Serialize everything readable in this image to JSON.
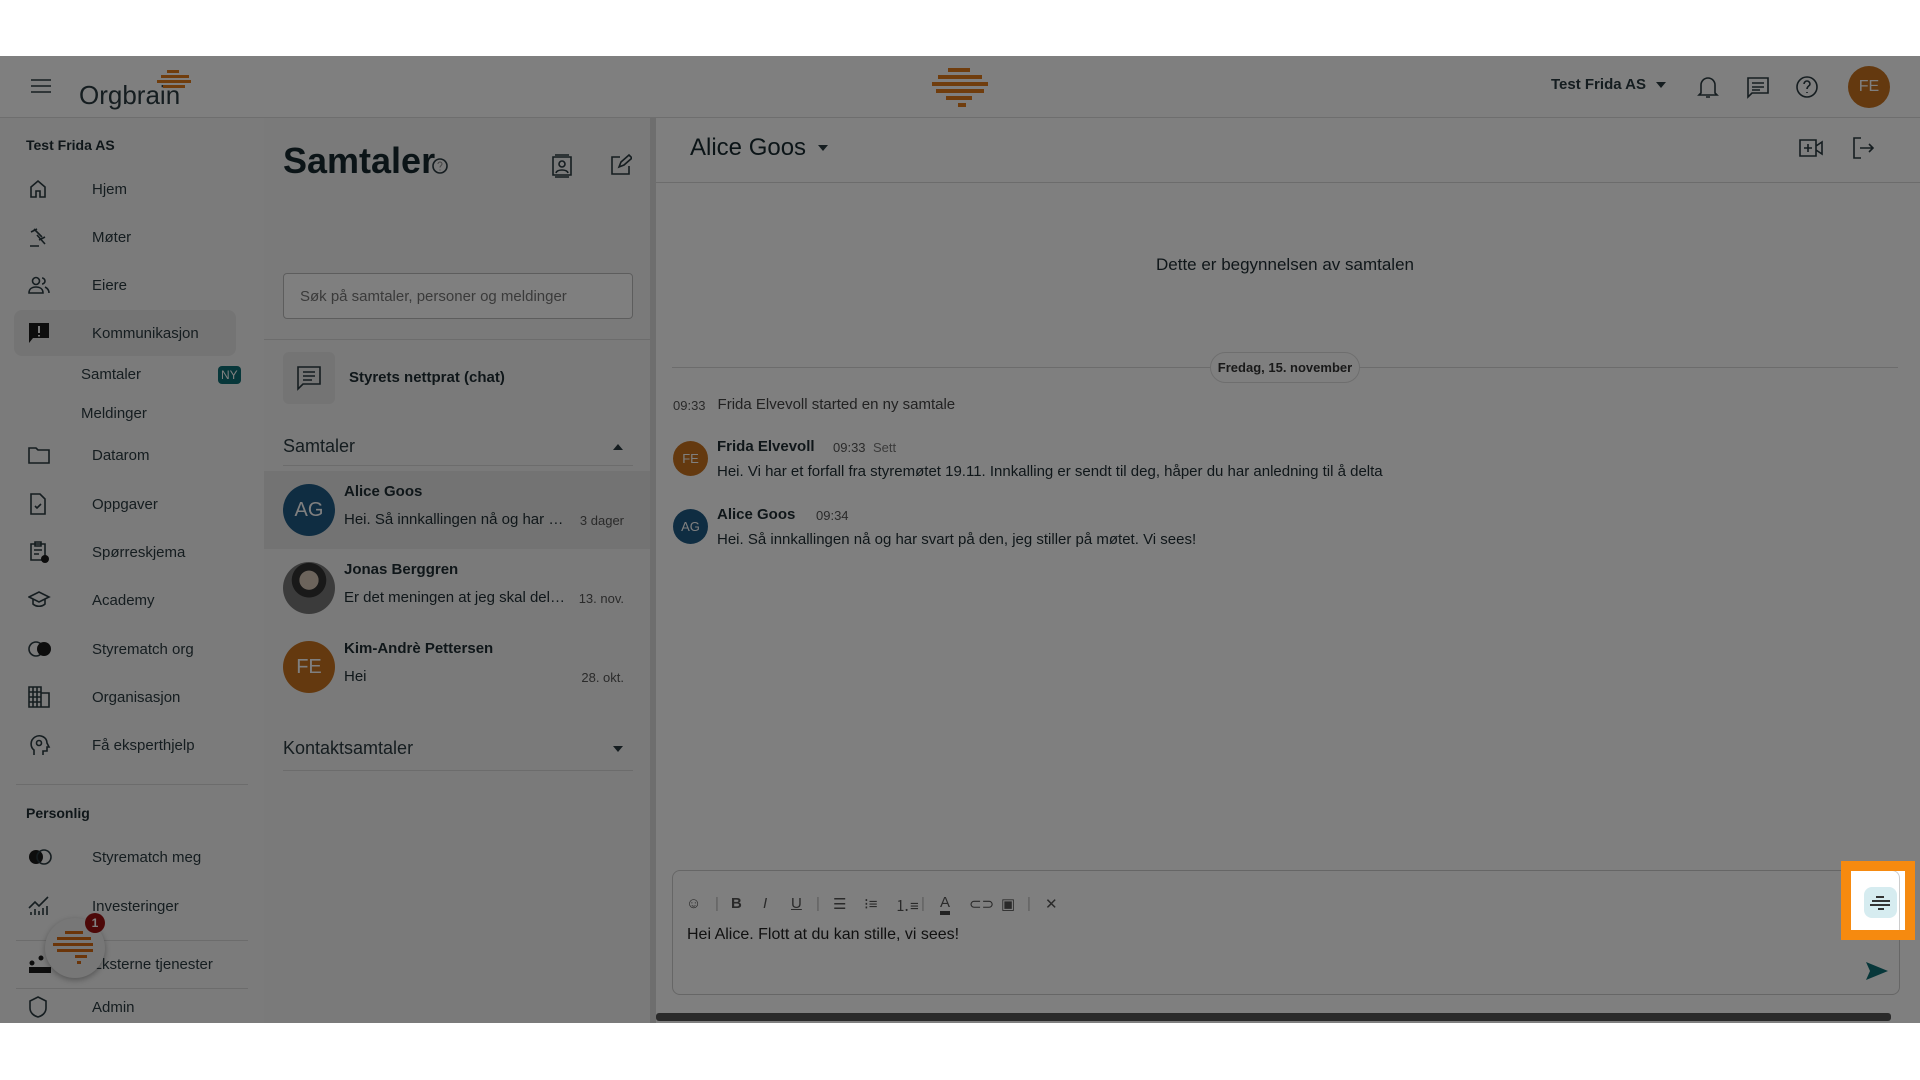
{
  "header": {
    "logo_text": "Orgbrain",
    "org_selector": "Test Frida AS",
    "avatar_initials": "FE",
    "icons": [
      "menu-icon",
      "bell-icon",
      "chat-icon",
      "help-icon"
    ]
  },
  "sidebar": {
    "org_title": "Test Frida AS",
    "items": [
      {
        "label": "Hjem",
        "icon": "home-icon"
      },
      {
        "label": "Møter",
        "icon": "gavel-icon"
      },
      {
        "label": "Eiere",
        "icon": "people-icon"
      },
      {
        "label": "Kommunikasjon",
        "icon": "feedback-icon",
        "active": true
      },
      {
        "label": "Datarom",
        "icon": "folder-icon"
      },
      {
        "label": "Oppgaver",
        "icon": "task-icon"
      },
      {
        "label": "Spørreskjema",
        "icon": "survey-icon"
      },
      {
        "label": "Academy",
        "icon": "school-icon"
      },
      {
        "label": "Styrematch org",
        "icon": "match-icon"
      },
      {
        "label": "Organisasjon",
        "icon": "building-icon"
      },
      {
        "label": "Få eksperthjelp",
        "icon": "expert-icon"
      }
    ],
    "subitems": [
      {
        "label": "Samtaler",
        "badge": "NY"
      },
      {
        "label": "Meldinger"
      }
    ],
    "personal_title": "Personlig",
    "personal_items": [
      {
        "label": "Styrematch meg"
      },
      {
        "label": "Investeringer"
      },
      {
        "label": "Eksterne tjenester"
      },
      {
        "label": "Admin"
      }
    ],
    "assistant_badge": "1"
  },
  "list": {
    "title": "Samtaler",
    "search_placeholder": "Søk på samtaler, personer og meldinger",
    "board_chat": "Styrets nettprat (chat)",
    "section_conversations": "Samtaler",
    "section_contacts": "Kontaktsamtaler",
    "conversations": [
      {
        "name": "Alice Goos",
        "initials": "AG",
        "preview": "Hei. Så innkallingen nå og har svart på den, jeg stiller på møtet. Vi sees!",
        "time": "3 dager",
        "color": "#1f5a85"
      },
      {
        "name": "Jonas Berggren",
        "initials": "",
        "preview": "Er det meningen at jeg skal delta på møtet?",
        "time": "13. nov.",
        "color": "#555"
      },
      {
        "name": "Kim-Andrè Pettersen",
        "initials": "FE",
        "preview": "Hei",
        "time": "28. okt.",
        "color": "#c8731f"
      }
    ]
  },
  "chat": {
    "title": "Alice Goos",
    "start_text": "Dette er begynnelsen av samtalen",
    "date": "Fredag, 15. november",
    "system": {
      "time": "09:33",
      "text": "Frida Elvevoll started en ny samtale"
    },
    "messages": [
      {
        "name": "Frida Elvevoll",
        "initials": "FE",
        "time": "09:33",
        "status": "Sett",
        "text": "Hei. Vi har et forfall fra styremøtet 19.11. Innkalling er sendt til deg, håper du har anledning til å delta",
        "color": "#c8731f"
      },
      {
        "name": "Alice Goos",
        "initials": "AG",
        "time": "09:34",
        "status": "",
        "text": "Hei. Så innkallingen nå og har svart på den, jeg stiller på møtet. Vi sees!",
        "color": "#1f5a85"
      }
    ],
    "composer_value": "Hei Alice. Flott at du kan stille, vi sees!"
  },
  "colors": {
    "brand_orange": "#e07a1a",
    "teal": "#0e6e74",
    "highlight": "#f68a0f"
  }
}
